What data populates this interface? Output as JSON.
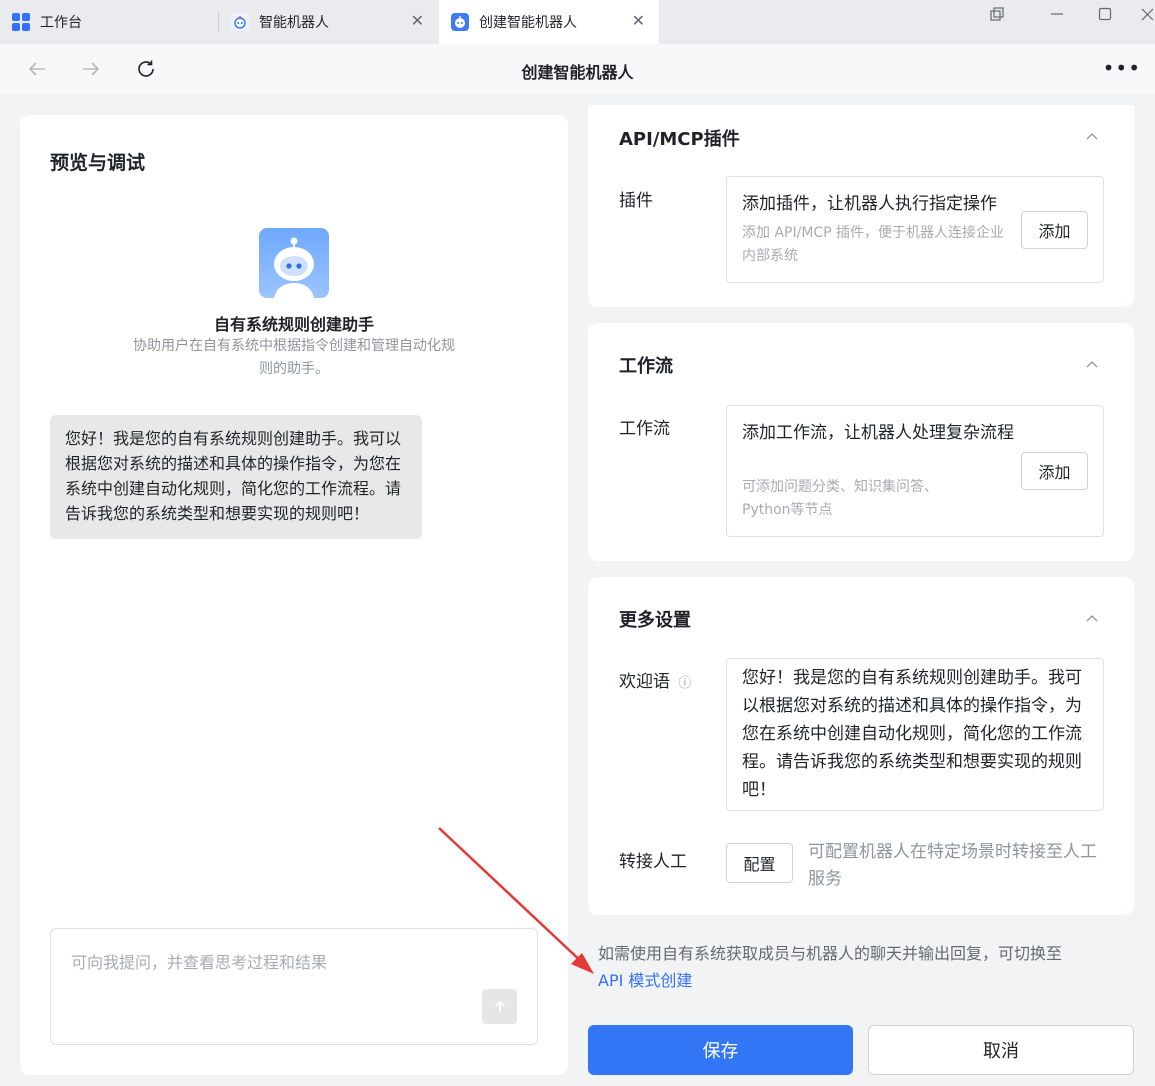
{
  "tabs": [
    {
      "label": "工作台",
      "icon": "grid-icon",
      "closable": false
    },
    {
      "label": "智能机器人",
      "icon": "robot-icon",
      "closable": true
    },
    {
      "label": "创建智能机器人",
      "icon": "robot-icon",
      "closable": true,
      "active": true
    }
  ],
  "tab_close_glyph": "✕",
  "nav": {
    "title": "创建智能机器人",
    "more": "•••"
  },
  "preview": {
    "title": "预览与调试",
    "bot_name": "自有系统规则创建助手",
    "bot_desc": "协助用户在自有系统中根据指令创建和管理自动化规则的助手。",
    "welcome_message": "您好！我是您的自有系统规则创建助手。我可以根据您对系统的描述和具体的操作指令，为您在系统中创建自动化规则，简化您的工作流程。请告诉我您的系统类型和想要实现的规则吧！",
    "input_placeholder": "可向我提问，并查看思考过程和结果"
  },
  "plugins": {
    "title": "API/MCP插件",
    "label": "插件",
    "main": "添加插件，让机器人执行指定操作",
    "sub": "添加 API/MCP 插件，便于机器人连接企业内部系统",
    "button": "添加"
  },
  "workflow": {
    "title": "工作流",
    "label": "工作流",
    "main": "添加工作流，让机器人处理复杂流程",
    "sub": "可添加问题分类、知识集问答、Python等节点",
    "button": "添加"
  },
  "more_settings": {
    "title": "更多设置",
    "greeting_label": "欢迎语",
    "greeting_info": "ⓘ",
    "greeting_text": "您好！我是您的自有系统规则创建助手。我可以根据您对系统的描述和具体的操作指令，为您在系统中创建自动化规则，简化您的工作流程。请告诉我您的系统类型和想要实现的规则吧！",
    "handover_label": "转接人工",
    "config_button": "配置",
    "handover_desc": "可配置机器人在特定场景时转接至人工服务"
  },
  "switch_note": "如需使用自有系统获取成员与机器人的聊天并输出回复，可切换至",
  "api_link": "API 模式创建",
  "footer": {
    "save": "保存",
    "cancel": "取消"
  },
  "colors": {
    "accent": "#3376f5",
    "annotation_arrow": "#e53935"
  }
}
